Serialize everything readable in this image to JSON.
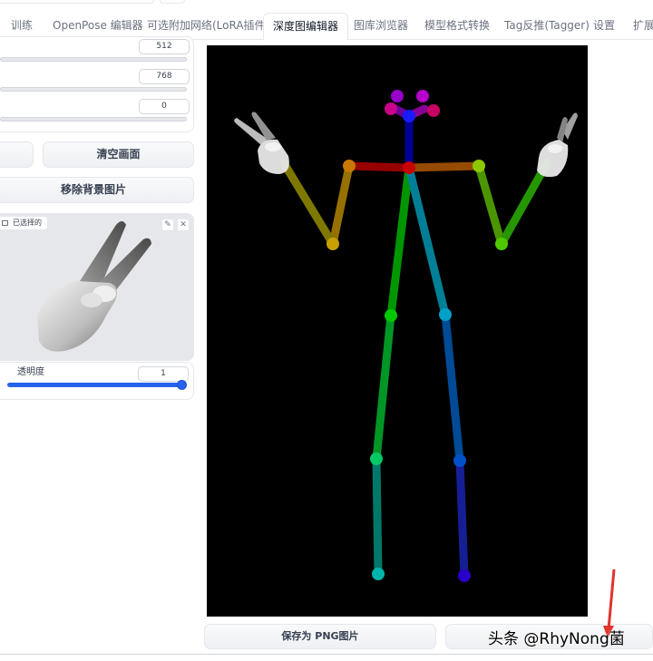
{
  "tabs": [
    {
      "label": "训练",
      "active": false
    },
    {
      "label": "OpenPose 编辑器",
      "active": false
    },
    {
      "label": "可选附加网络(LoRA插件)",
      "active": false
    },
    {
      "label": "深度图编辑器",
      "active": true
    },
    {
      "label": "图库浏览器",
      "active": false
    },
    {
      "label": "模型格式转换",
      "active": false
    },
    {
      "label": "Tag反推(Tagger)",
      "active": false
    },
    {
      "label": "设置",
      "active": false
    },
    {
      "label": "扩展",
      "active": false
    }
  ],
  "sliders": [
    {
      "value": "512"
    },
    {
      "value": "768"
    },
    {
      "value": "0"
    }
  ],
  "buttons": {
    "clear_canvas": "清空画面",
    "remove_background": "移除背景图片",
    "save_png": "保存为 PNG图片"
  },
  "image_card": {
    "label": "已选择的",
    "edit_icon": "pencil-icon",
    "close_icon": "close-icon"
  },
  "opacity": {
    "label": "透明度",
    "value": "1",
    "fraction": 1.0
  },
  "canvas": {
    "background": "#000000"
  },
  "watermark": "头条 @RhyNong菌",
  "colors": {
    "accent": "#2563eb",
    "red_arrow": "#e0342c"
  }
}
